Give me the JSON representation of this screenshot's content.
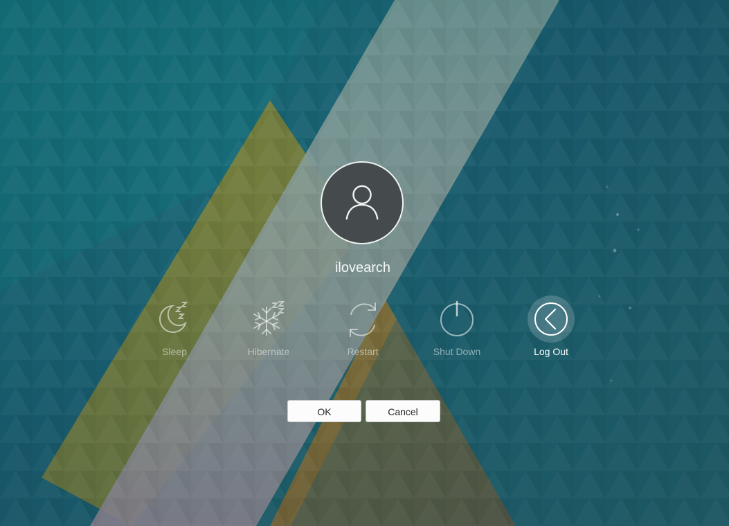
{
  "user": {
    "name": "ilovearch"
  },
  "actions": [
    {
      "id": "sleep",
      "label": "Sleep",
      "icon": "sleep-icon",
      "active": false
    },
    {
      "id": "hibernate",
      "label": "Hibernate",
      "icon": "hibernate-icon",
      "active": false
    },
    {
      "id": "restart",
      "label": "Restart",
      "icon": "restart-icon",
      "active": false
    },
    {
      "id": "shutdown",
      "label": "Shut Down",
      "icon": "power-icon",
      "active": false
    },
    {
      "id": "logout",
      "label": "Log Out",
      "icon": "logout-icon",
      "active": true
    }
  ],
  "buttons": {
    "ok": "OK",
    "cancel": "Cancel"
  },
  "colors": {
    "background": "#1f5f6e",
    "avatar_fill": "#454a4c",
    "button_fill": "#fcfcfc"
  }
}
